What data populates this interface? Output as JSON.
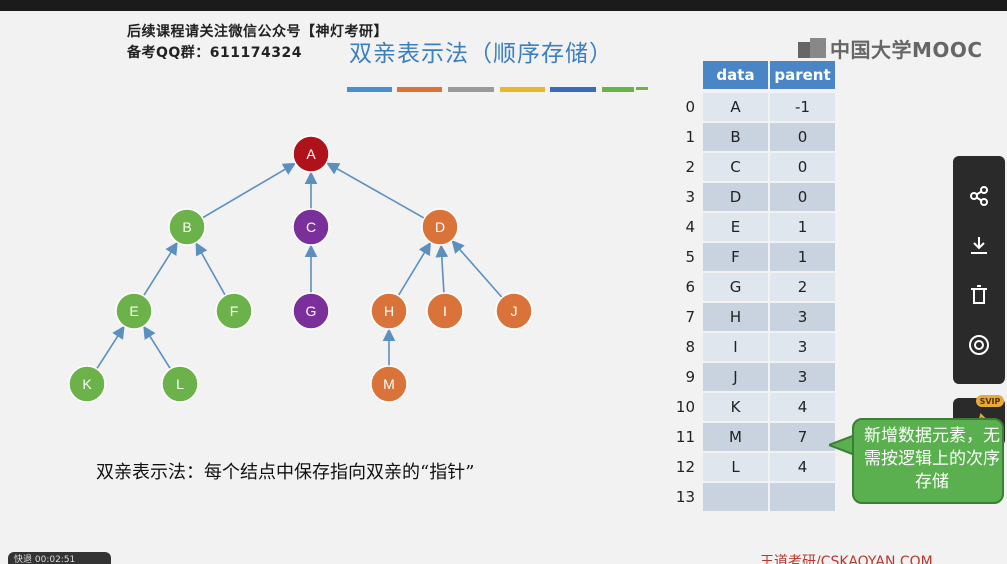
{
  "promo": {
    "line1": "后续课程请关注微信公众号【神灯考研】",
    "line2": "备考QQ群：611174324"
  },
  "title": "双亲表示法（顺序存储）",
  "logo": "中国大学MOOC",
  "colors": {
    "title": "#3a7fc1",
    "red": "#b0121b",
    "purple": "#7a2f9a",
    "green": "#6cb24a",
    "orange": "#d9733a",
    "table_header": "#4a86c5",
    "table_row_a": "#dfe6ee",
    "table_row_b": "#c8d3df",
    "bubble": "#5ab04e"
  },
  "tree": {
    "nodes": [
      {
        "id": "A",
        "label": "A",
        "color": "red"
      },
      {
        "id": "B",
        "label": "B",
        "color": "green"
      },
      {
        "id": "C",
        "label": "C",
        "color": "purple"
      },
      {
        "id": "D",
        "label": "D",
        "color": "orange"
      },
      {
        "id": "E",
        "label": "E",
        "color": "green"
      },
      {
        "id": "F",
        "label": "F",
        "color": "green"
      },
      {
        "id": "G",
        "label": "G",
        "color": "purple"
      },
      {
        "id": "H",
        "label": "H",
        "color": "orange"
      },
      {
        "id": "I",
        "label": "I",
        "color": "orange"
      },
      {
        "id": "J",
        "label": "J",
        "color": "orange"
      },
      {
        "id": "K",
        "label": "K",
        "color": "green"
      },
      {
        "id": "L",
        "label": "L",
        "color": "green"
      },
      {
        "id": "M",
        "label": "M",
        "color": "orange"
      }
    ],
    "edges": [
      [
        "B",
        "A"
      ],
      [
        "C",
        "A"
      ],
      [
        "D",
        "A"
      ],
      [
        "E",
        "B"
      ],
      [
        "F",
        "B"
      ],
      [
        "G",
        "C"
      ],
      [
        "H",
        "D"
      ],
      [
        "I",
        "D"
      ],
      [
        "J",
        "D"
      ],
      [
        "K",
        "E"
      ],
      [
        "L",
        "E"
      ],
      [
        "M",
        "H"
      ]
    ]
  },
  "caption": "双亲表示法：每个结点中保存指向双亲的“指针”",
  "table": {
    "headers": [
      "data",
      "parent"
    ],
    "rows": [
      {
        "index": "0",
        "data": "A",
        "parent": "-1"
      },
      {
        "index": "1",
        "data": "B",
        "parent": "0"
      },
      {
        "index": "2",
        "data": "C",
        "parent": "0"
      },
      {
        "index": "3",
        "data": "D",
        "parent": "0"
      },
      {
        "index": "4",
        "data": "E",
        "parent": "1"
      },
      {
        "index": "5",
        "data": "F",
        "parent": "1"
      },
      {
        "index": "6",
        "data": "G",
        "parent": "2"
      },
      {
        "index": "7",
        "data": "H",
        "parent": "3"
      },
      {
        "index": "8",
        "data": "I",
        "parent": "3"
      },
      {
        "index": "9",
        "data": "J",
        "parent": "3"
      },
      {
        "index": "10",
        "data": "K",
        "parent": "4"
      },
      {
        "index": "11",
        "data": "M",
        "parent": "7"
      },
      {
        "index": "12",
        "data": "L",
        "parent": "4"
      },
      {
        "index": "13",
        "data": "",
        "parent": ""
      }
    ]
  },
  "bubble": "新增数据元素，无需按逻辑上的次序存储",
  "side_panel": {
    "icons": [
      "share-icon",
      "download-icon",
      "delete-icon",
      "preview-icon"
    ],
    "badge": "SVIP",
    "pin": "pin-icon"
  },
  "footer": "王道考研/CSKAOYAN.COM",
  "bottom_pill": "快退 00:02:51"
}
